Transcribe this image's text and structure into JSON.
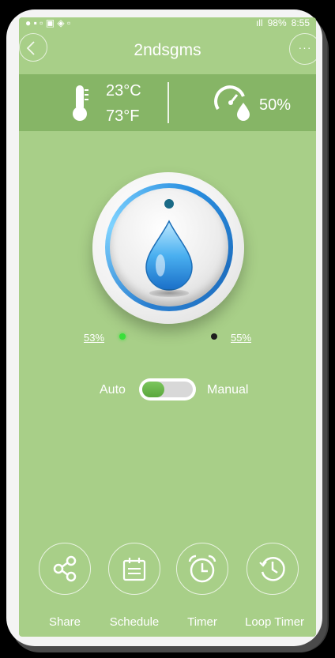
{
  "statusbar": {
    "signal": "all",
    "battery": "98%",
    "time": "8:55"
  },
  "header": {
    "title": "2ndsgms"
  },
  "environment": {
    "temperature_c": "23°C",
    "temperature_f": "73°F",
    "humidity": "50%"
  },
  "dial": {
    "range_min": "53%",
    "range_max": "55%"
  },
  "mode": {
    "auto_label": "Auto",
    "manual_label": "Manual"
  },
  "bottom_nav": {
    "share": "Share",
    "schedule": "Schedule",
    "timer": "Timer",
    "loop_timer": "Loop Timer"
  },
  "colors": {
    "background": "#a8cf88",
    "env_band": "#86b566",
    "accent_blue": "#2a8fe0",
    "indicator_green": "#3adf3a"
  },
  "icons": [
    "back-icon",
    "more-icon",
    "thermometer-icon",
    "humidity-gauge-icon",
    "water-drop-icon",
    "share-icon",
    "schedule-icon",
    "timer-icon",
    "loop-timer-icon"
  ]
}
